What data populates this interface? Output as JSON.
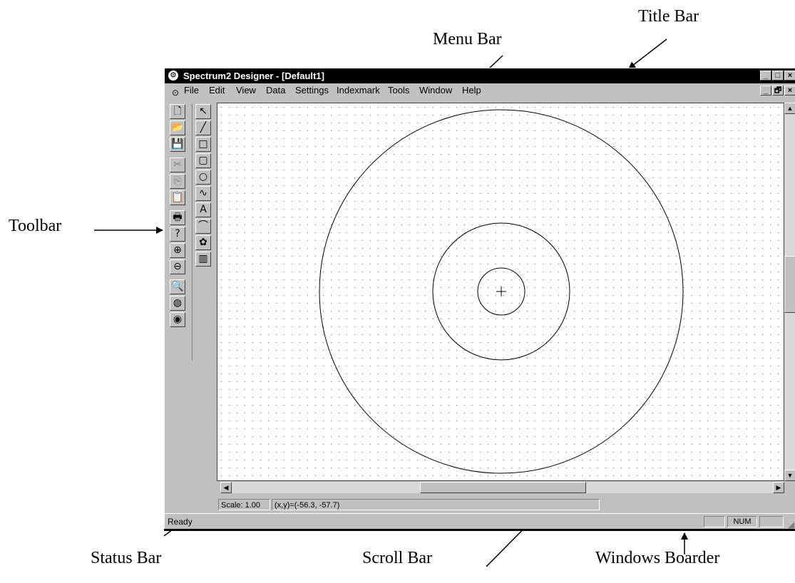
{
  "annotations": {
    "title_bar": "Title Bar",
    "menu_bar": "Menu Bar",
    "toolbar": "Toolbar",
    "status_bar": "Status Bar",
    "scroll_bar": "Scroll Bar",
    "windows_border": "Windows Boarder"
  },
  "window": {
    "title": "Spectrum2 Designer - [Default1]",
    "caption_buttons": [
      "_",
      "□",
      "×"
    ],
    "mdi_buttons": [
      "_",
      "🗗",
      "×"
    ]
  },
  "menu": [
    "File",
    "Edit",
    "View",
    "Data",
    "Settings",
    "Indexmark",
    "Tools",
    "Window",
    "Help"
  ],
  "toolbar_main": [
    {
      "icon": "new-document-icon",
      "glyph": "🗋",
      "enabled": true
    },
    {
      "icon": "open-folder-icon",
      "glyph": "📂",
      "enabled": true
    },
    {
      "icon": "save-disk-icon",
      "glyph": "💾",
      "enabled": true
    },
    {
      "icon": "cut-scissors-icon",
      "glyph": "✂",
      "enabled": false
    },
    {
      "icon": "copy-icon",
      "glyph": "⎘",
      "enabled": false
    },
    {
      "icon": "paste-icon",
      "glyph": "📋",
      "enabled": false
    },
    {
      "icon": "print-icon",
      "glyph": "🖶",
      "enabled": true
    },
    {
      "icon": "help-pointer-icon",
      "glyph": "?",
      "enabled": true
    },
    {
      "icon": "zoom-in-icon",
      "glyph": "⊕",
      "enabled": true
    },
    {
      "icon": "zoom-out-icon",
      "glyph": "⊖",
      "enabled": true
    },
    {
      "icon": "zoom-icon",
      "glyph": "🔍",
      "enabled": true
    },
    {
      "icon": "disc-pattern-icon",
      "glyph": "◍",
      "enabled": true
    },
    {
      "icon": "disc-center-icon",
      "glyph": "◉",
      "enabled": true
    }
  ],
  "toolbar_draw": [
    {
      "icon": "select-arrow-icon",
      "glyph": "↖"
    },
    {
      "icon": "line-tool-icon",
      "glyph": "╱"
    },
    {
      "icon": "rectangle-tool-icon",
      "glyph": "□"
    },
    {
      "icon": "rounded-rectangle-tool-icon",
      "glyph": "▢"
    },
    {
      "icon": "ellipse-tool-icon",
      "glyph": "○"
    },
    {
      "icon": "freehand-tool-icon",
      "glyph": "∿"
    },
    {
      "icon": "text-tool-icon",
      "glyph": "A"
    },
    {
      "icon": "arc-text-tool-icon",
      "glyph": "⌒"
    },
    {
      "icon": "image-tool-icon",
      "glyph": "✿"
    },
    {
      "icon": "barcode-tool-icon",
      "glyph": "▥"
    }
  ],
  "status": {
    "scale": "Scale: 1.00",
    "coords": "(x,y)=(-56.3, -57.7)",
    "ready": "Ready",
    "num": "NUM"
  }
}
